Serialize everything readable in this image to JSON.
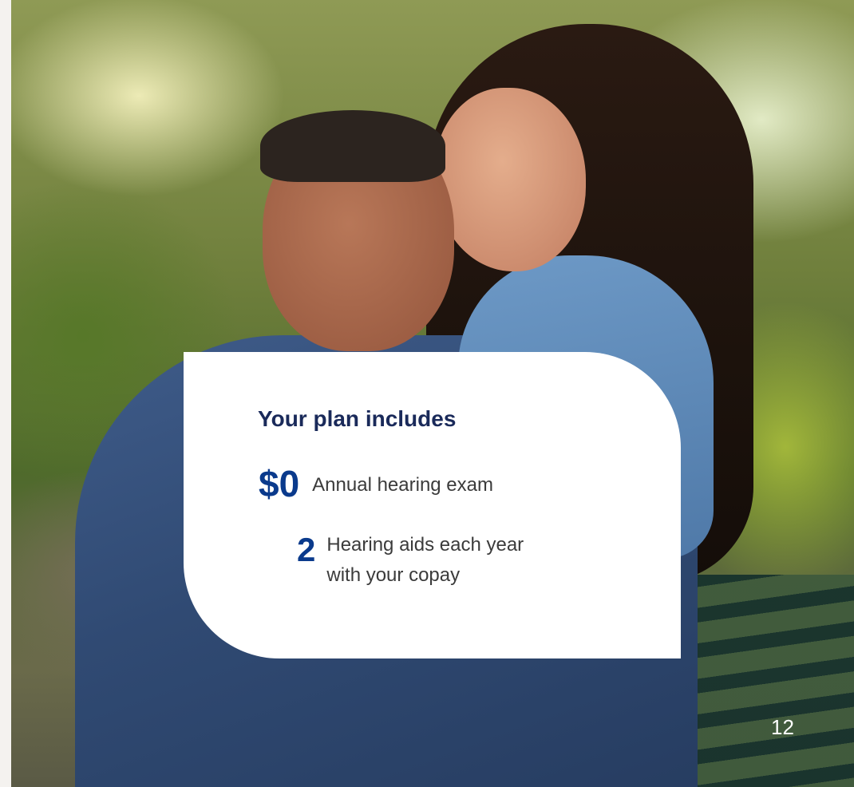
{
  "card": {
    "title": "Your plan includes",
    "items": [
      {
        "value": "$0",
        "description_lines": [
          "Annual hearing exam"
        ]
      },
      {
        "value": "2",
        "description_lines": [
          "Hearing aids each year",
          "with your copay"
        ]
      }
    ]
  },
  "page_number": "12",
  "colors": {
    "title": "#1a2a5a",
    "accent_blue": "#0a3a8c",
    "card_background": "#ffffff",
    "body_text": "#3b3b3b"
  }
}
